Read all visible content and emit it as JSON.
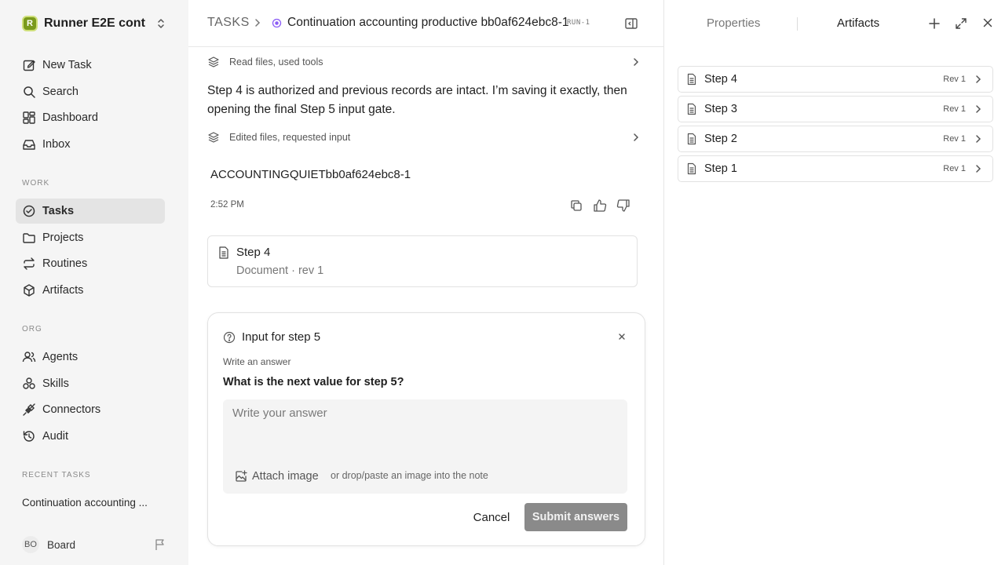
{
  "workspace": {
    "initial": "R",
    "name": "Runner E2E conti..."
  },
  "nav": {
    "primary": [
      {
        "label": "New Task",
        "icon": "edit-icon"
      },
      {
        "label": "Search",
        "icon": "search-icon"
      },
      {
        "label": "Dashboard",
        "icon": "dashboard-icon"
      },
      {
        "label": "Inbox",
        "icon": "inbox-icon"
      }
    ],
    "work_label": "WORK",
    "work": [
      {
        "label": "Tasks",
        "icon": "check-circle-icon",
        "active": true
      },
      {
        "label": "Projects",
        "icon": "folder-icon"
      },
      {
        "label": "Routines",
        "icon": "repeat-icon"
      },
      {
        "label": "Artifacts",
        "icon": "box-icon"
      }
    ],
    "org_label": "ORG",
    "org": [
      {
        "label": "Agents",
        "icon": "users-icon"
      },
      {
        "label": "Skills",
        "icon": "skills-icon"
      },
      {
        "label": "Connectors",
        "icon": "plug-icon"
      },
      {
        "label": "Audit",
        "icon": "history-icon"
      }
    ],
    "recent_label": "RECENT TASKS",
    "recent": [
      {
        "label": "Continuation accounting ..."
      }
    ]
  },
  "user": {
    "initials": "BO",
    "name": "Board"
  },
  "header": {
    "root": "TASKS",
    "title": "Continuation accounting productive bb0af624ebc8-1",
    "badge": "RUN-1"
  },
  "thread": {
    "activity1": "Read files, used tools",
    "message": "Step 4 is authorized and previous records are intact. I’m saving it exactly, then opening the final Step 5 input gate.",
    "activity2": "Edited files, requested input",
    "answer": "ACCOUNTINGQUIETbb0af624ebc8-1",
    "time": "2:52 PM",
    "doc": {
      "title": "Step 4",
      "subtitle": "Document · rev 1"
    }
  },
  "input_request": {
    "title": "Input for step 5",
    "label": "Write an answer",
    "question": "What is the next value for step 5?",
    "placeholder": "Write your answer",
    "attach_label": "Attach image",
    "attach_hint": "or drop/paste an image into the note",
    "cancel_label": "Cancel",
    "submit_label": "Submit answers"
  },
  "right_panel": {
    "tabs": [
      "Properties",
      "Artifacts"
    ],
    "active_tab": "Artifacts",
    "artifacts": [
      {
        "name": "Step 4",
        "rev": "Rev 1"
      },
      {
        "name": "Step 3",
        "rev": "Rev 1"
      },
      {
        "name": "Step 2",
        "rev": "Rev 1"
      },
      {
        "name": "Step 1",
        "rev": "Rev 1"
      }
    ]
  },
  "colors": {
    "accent_status": "#8b5cf6",
    "submit_disabled": "#8a8a8a",
    "sidebar_bg": "#f5f5f5",
    "active_nav": "#e4e4e4"
  }
}
